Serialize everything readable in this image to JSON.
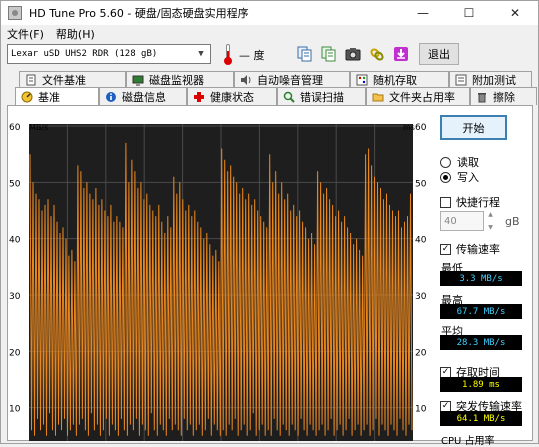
{
  "window": {
    "title": "HD Tune Pro 5.60 - 硬盘/固态硬盘实用程序"
  },
  "window_buttons": {
    "minimize": "—",
    "maximize": "☐",
    "close": "✕"
  },
  "menu": [
    "文件(F)",
    "帮助(H)"
  ],
  "toolbar": {
    "drive": "Lexar  uSD UHS2 RDR (128 gB)",
    "temperature": "— 度",
    "exit_label": "退出",
    "icons": [
      "copy-icon",
      "copy-all-icon",
      "camera-icon",
      "link-icon",
      "download-icon"
    ]
  },
  "tabs_row1": [
    {
      "label": "文件基准",
      "icon": "file-icon"
    },
    {
      "label": "磁盘监视器",
      "icon": "monitor-icon"
    },
    {
      "label": "自动噪音管理",
      "icon": "speaker-icon"
    },
    {
      "label": "随机存取",
      "icon": "random-icon"
    },
    {
      "label": "附加测试",
      "icon": "extra-icon"
    }
  ],
  "tabs_row2": [
    {
      "label": "基准",
      "icon": "benchmark-icon",
      "active": true
    },
    {
      "label": "磁盘信息",
      "icon": "info-icon"
    },
    {
      "label": "健康状态",
      "icon": "health-icon"
    },
    {
      "label": "错误扫描",
      "icon": "scan-icon"
    },
    {
      "label": "文件夹占用率",
      "icon": "folder-icon"
    },
    {
      "label": "擦除",
      "icon": "trash-icon"
    }
  ],
  "side": {
    "start_label": "开始",
    "read_label": "读取",
    "write_label": "写入",
    "selected_mode": "write",
    "short_stroke_label": "快捷行程",
    "short_stroke_checked": false,
    "short_stroke_value": "40",
    "short_stroke_unit": "gB",
    "transfer_rate_label": "传输速率",
    "transfer_rate_checked": true,
    "min_label": "最低",
    "min_value": "3.3 MB/s",
    "max_label": "最高",
    "max_value": "67.7 MB/s",
    "avg_label": "平均",
    "avg_value": "28.3 MB/s",
    "access_time_label": "存取时间",
    "access_time_checked": true,
    "access_time_value": "1.89 ms",
    "burst_label": "突发传输速率",
    "burst_checked": true,
    "burst_value": "64.1 MB/s",
    "cpu_label": "CPU 占用率"
  },
  "colors": {
    "chart_bg": "#1e1e1e",
    "grid": "#4a4a4a",
    "line": "#e8871e",
    "stat_text": "#ffff00",
    "stat_text_alt": "#40d0ff",
    "start_border": "#3c7fb1"
  },
  "chart_data": {
    "type": "line",
    "y_left_unit": "MB/s",
    "y_right_unit": "ms",
    "y_left_ticks": [
      60,
      50,
      40,
      30,
      20,
      10
    ],
    "y_right_ticks": [
      60,
      50,
      40,
      30,
      20,
      10
    ],
    "ylim": [
      0,
      60
    ],
    "grid": true,
    "series": [
      {
        "values": [
          55,
          6,
          50,
          5,
          48,
          8,
          47,
          6,
          45,
          7,
          46,
          5,
          47,
          9,
          44,
          6,
          46,
          5,
          43,
          7,
          41,
          6,
          42,
          8,
          40,
          5,
          37,
          6,
          38,
          7,
          36,
          5,
          53,
          7,
          52,
          8,
          49,
          6,
          50,
          5,
          48,
          9,
          47,
          6,
          49,
          7,
          46,
          5,
          47,
          6,
          45,
          8,
          44,
          5,
          46,
          7,
          43,
          6,
          44,
          5,
          43,
          8,
          42,
          6,
          57,
          5,
          50,
          7,
          54,
          6,
          52,
          8,
          49,
          5,
          50,
          7,
          47,
          6,
          48,
          5,
          46,
          9,
          45,
          6,
          44,
          5,
          46,
          7,
          43,
          6,
          41,
          5,
          44,
          8,
          42,
          6,
          51,
          7,
          48,
          6,
          50,
          5,
          47,
          8,
          45,
          6,
          46,
          7,
          44,
          5,
          45,
          6,
          43,
          7,
          42,
          5,
          40,
          6,
          41,
          8,
          39,
          5,
          37,
          7,
          38,
          6,
          36,
          5,
          56,
          6,
          54,
          5,
          52,
          7,
          53,
          6,
          51,
          8,
          50,
          5,
          48,
          6,
          49,
          7,
          47,
          5,
          48,
          6,
          46,
          9,
          47,
          5,
          45,
          6,
          44,
          7,
          43,
          5,
          42,
          6,
          55,
          5,
          50,
          8,
          52,
          6,
          48,
          5,
          50,
          7,
          47,
          6,
          48,
          5,
          45,
          7,
          46,
          6,
          44,
          5,
          45,
          8,
          43,
          6,
          42,
          5,
          40,
          7,
          41,
          6,
          39,
          5,
          52,
          6,
          50,
          7,
          48,
          5,
          49,
          6,
          47,
          8,
          46,
          5,
          44,
          6,
          45,
          7,
          43,
          5,
          44,
          6,
          42,
          8,
          41,
          5,
          39,
          6,
          40,
          7,
          38,
          5,
          37,
          6,
          55,
          7,
          56,
          5,
          53,
          6,
          51,
          8,
          50,
          5,
          49,
          7,
          47,
          6,
          48,
          5,
          46,
          7,
          45,
          6,
          44,
          5,
          45,
          8,
          42,
          6,
          43,
          5,
          44,
          7,
          48,
          6
        ]
      }
    ]
  }
}
